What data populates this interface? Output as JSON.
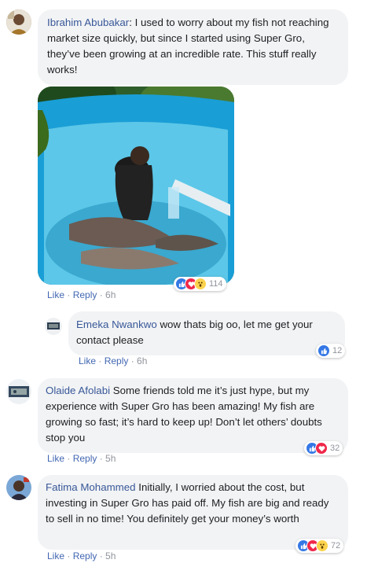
{
  "comments": [
    {
      "author": "Ibrahim Abubakar",
      "text": "I used to worry about my fish not reaching market size quickly, but since I started using Super Gro, they’ve been growing at an incredible rate. This stuff really works!",
      "reaction_count": "114",
      "reactions": [
        "like-icon",
        "love-icon",
        "wow-icon"
      ],
      "time": "6h"
    },
    {
      "author": "Emeka Nwankwo",
      "text": "wow thats big oo, let me get your contact please",
      "reaction_count": "12",
      "reactions": [
        "like-icon"
      ],
      "time": "6h"
    },
    {
      "author": "Olaide Afolabi",
      "text": "Some friends told me it’s just hype, but my experience with Super Gro has been amazing! My fish are growing so fast; it’s hard to keep up! Don’t let others’ doubts stop you",
      "reaction_count": "32",
      "reactions": [
        "like-icon",
        "love-icon"
      ],
      "time": "5h"
    },
    {
      "author": "Fatima Mohammed",
      "text": "Initially, I worried about the cost, but investing in Super Gro has paid off. My fish are big and ready to sell in no time! You definitely get your money’s worth",
      "reaction_count": "72",
      "reactions": [
        "like-icon",
        "love-icon",
        "wow-icon"
      ],
      "time": "5h"
    }
  ],
  "actions": {
    "like": "Like",
    "reply": "Reply",
    "sep": " · "
  }
}
